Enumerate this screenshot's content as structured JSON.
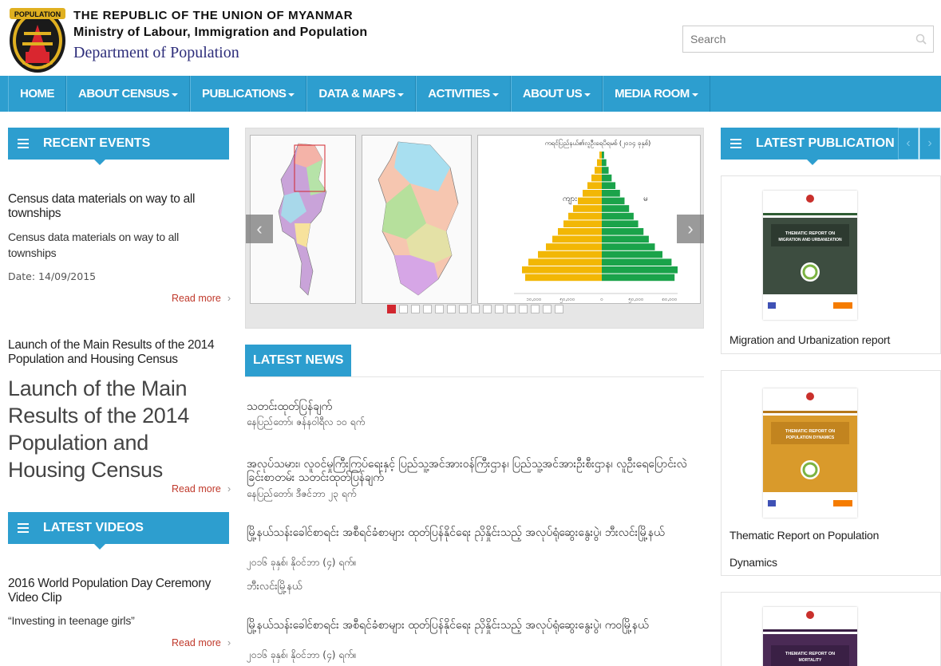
{
  "header": {
    "line1": "THE REPUBLIC OF THE UNION OF MYANMAR",
    "line2": "Ministry of Labour, Immigration and Population",
    "line3": "Department of Population",
    "logo_text": "POPULATION"
  },
  "search": {
    "placeholder": "Search"
  },
  "nav": {
    "items": [
      {
        "label": "HOME",
        "dropdown": false
      },
      {
        "label": "ABOUT CENSUS",
        "dropdown": true
      },
      {
        "label": "PUBLICATIONS",
        "dropdown": true
      },
      {
        "label": "DATA & MAPS",
        "dropdown": true
      },
      {
        "label": "ACTIVITIES",
        "dropdown": true
      },
      {
        "label": "ABOUT US",
        "dropdown": true
      },
      {
        "label": "MEDIA ROOM",
        "dropdown": true
      }
    ]
  },
  "recent_events": {
    "heading": "RECENT EVENTS",
    "items": [
      {
        "title": "Census data materials on way to all townships",
        "desc": "Census data materials on way to all townships",
        "date": "Date: 14/09/2015",
        "read_more": "Read more"
      },
      {
        "title": "Launch of the Main Results of the 2014 Population and Housing Census",
        "big": "Launch of the Main Results of the 2014 Population and Housing Census",
        "read_more": "Read more"
      }
    ]
  },
  "latest_videos": {
    "heading": "LATEST VIDEOS",
    "items": [
      {
        "title": "2016 World Population Day Ceremony Video Clip",
        "desc": "“Investing in teenage girls”",
        "read_more": "Read more"
      }
    ]
  },
  "slider": {
    "chart_title": "ကရင်ပြည်နယ်၏လူဦးရေပိရမစ် (၂၀၁၄ ခုနှစ်)",
    "male_label": "ကျား",
    "female_label": "မ",
    "x_ticks": [
      "၁၀,၀၀၀",
      "၅၀,၀၀၀",
      "၀",
      "၅၀,၀၀၀",
      "၈၀,၀၀၀"
    ],
    "dots_count": 15,
    "active_dot": 0,
    "prev": "‹",
    "next": "›",
    "colors": {
      "male": "#f2b705",
      "female": "#1aa34a"
    }
  },
  "latest_news": {
    "heading": "LATEST NEWS",
    "items": [
      {
        "title": "သတင်းထုတ်ပြန်ချက်",
        "date": "နေပြည်တော်၊ ဇန်နဝါရီလ ၁၀ ရက်"
      },
      {
        "title": "အလုပ်သမား၊ လူဝင်မှုကြီးကြပ်ရေးနှင့် ပြည်သူ့အင်အားဝန်ကြီးဌာန၊ ပြည်သူ့အင်အားဦးစီးဌာန၊ လူဦးရေပြောင်းလဲခြင်းစာတမ်း သတင်းထုတ်ပြန်ချက်",
        "date": "နေပြည်တော်၊ ဒီဇင်ဘာ ၂၃ ရက်"
      },
      {
        "title": "မြို့နယ်သန်းခေါင်စာရင်း အစီရင်ခံစာများ ထုတ်ပြန်နိုင်ရေး ညှိနှိုင်းသည့် အလုပ်ရုံဆွေးနွေးပွဲ၊ ဘီးလင်းမြို့နယ်",
        "date": "၂၀၁၆ ခုနှစ်၊ နိုဝင်ဘာ (၄) ရက်။",
        "extra": "ဘီးလင်းမြို့နယ်"
      },
      {
        "title": "မြို့နယ်သန်းခေါင်စာရင်း အစီရင်ခံစာများ ထုတ်ပြန်နိုင်ရေး ညှိနှိုင်းသည့် အလုပ်ရုံဆွေးနွေးပွဲ၊ ကဝမြို့နယ်",
        "date": "၂၀၁၆ ခုနှစ်၊ နိုဝင်ဘာ (၄) ရက်။"
      }
    ]
  },
  "latest_publication": {
    "heading": "LATEST PUBLICATION",
    "prev": "‹",
    "next": "›",
    "items": [
      {
        "title": "Migration and Urbanization report",
        "cover_color": "#3d4d40",
        "cover_text": "THEMATIC REPORT ON MIGRATION AND URBANIZATION"
      },
      {
        "title": "Thematic Report on Population Dynamics",
        "cover_color": "#d99a2b",
        "cover_text": "THEMATIC REPORT ON POPULATION DYNAMICS"
      },
      {
        "title": "",
        "cover_color": "#4a2a55",
        "cover_text": "THEMATIC REPORT ON MORTALITY"
      }
    ]
  }
}
